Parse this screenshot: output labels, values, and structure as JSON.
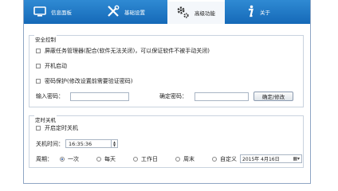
{
  "tabs": [
    {
      "label": "信息面板",
      "icon": "monitor-icon"
    },
    {
      "label": "基础设置",
      "icon": "tools-icon"
    },
    {
      "label": "高级功能",
      "icon": "gears-icon",
      "active": true
    },
    {
      "label": "关于",
      "icon": "info-icon"
    }
  ],
  "security": {
    "title": "安全控制",
    "opt_task_manager": "屏蔽任务管理器(配合(软件无法关闭)，可以保证软件不被手动关闭)",
    "opt_autostart": "开机启动",
    "opt_password": "密码保护(修改设置前需要验证密码)",
    "input_password_label": "输入密码：",
    "input_password_value": "",
    "confirm_password_label": "确定密码：",
    "confirm_password_value": "",
    "confirm_button": "确定/修改"
  },
  "shutdown": {
    "title": "定时关机",
    "opt_enable": "开启定时关机",
    "time_label": "关机时间：",
    "time_value": "16:35:36",
    "period_label": "周期：",
    "periods": [
      "一次",
      "每天",
      "工作日",
      "周末",
      "自定义"
    ],
    "selected_period": "一次",
    "date_value": "2015年 4月16日"
  },
  "colors": {
    "accent": "#1a73c2",
    "tab_active": "#f4f7fb"
  }
}
